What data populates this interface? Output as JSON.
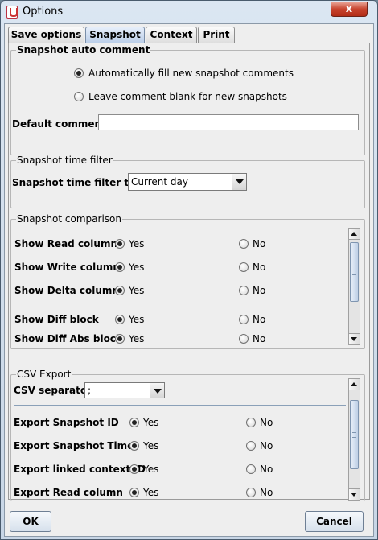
{
  "window": {
    "title": "Options",
    "close_label": "x"
  },
  "tabs": [
    {
      "label": "Save options"
    },
    {
      "label": "Snapshot"
    },
    {
      "label": "Context"
    },
    {
      "label": "Print"
    }
  ],
  "auto_comment": {
    "legend": "Snapshot auto comment",
    "option_fill": "Automatically fill new snapshot comments",
    "option_blank": "Leave comment blank for new snapshots",
    "default_comment_label": "Default comment :",
    "default_comment_value": ""
  },
  "time_filter": {
    "legend": "Snapshot time filter",
    "type_label": "Snapshot time filter type:",
    "type_value": "Current day"
  },
  "comparison": {
    "legend": "Snapshot comparison",
    "rows": [
      {
        "label": "Show Read column",
        "yes": "Yes",
        "no": "No"
      },
      {
        "label": "Show Write column",
        "yes": "Yes",
        "no": "No"
      },
      {
        "label": "Show Delta column",
        "yes": "Yes",
        "no": "No"
      },
      {
        "label": "Show Diff block",
        "yes": "Yes",
        "no": "No"
      },
      {
        "label": "Show Diff Abs block",
        "yes": "Yes",
        "no": "No"
      }
    ]
  },
  "csv": {
    "legend": "CSV Export",
    "separator_label": "CSV separator",
    "separator_value": ";",
    "rows": [
      {
        "label": "Export Snapshot ID",
        "yes": "Yes",
        "no": "No"
      },
      {
        "label": "Export Snapshot Time",
        "yes": "Yes",
        "no": "No"
      },
      {
        "label": "Export linked context ID",
        "yes": "Yes",
        "no": "No"
      },
      {
        "label": "Export Read column",
        "yes": "Yes",
        "no": "No"
      }
    ]
  },
  "buttons": {
    "ok": "OK",
    "cancel": "Cancel"
  }
}
